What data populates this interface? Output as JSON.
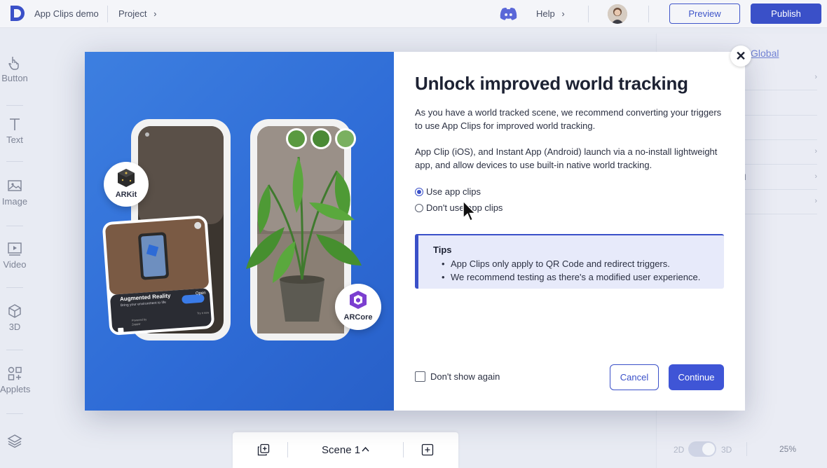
{
  "topbar": {
    "app_name": "App Clips demo",
    "project_label": "Project",
    "project_chevron": "›",
    "help_label": "Help",
    "help_chevron": "›",
    "preview_label": "Preview",
    "publish_label": "Publish"
  },
  "sidebar": {
    "items": [
      {
        "label": "Button",
        "icon": "hand-pointer-icon"
      },
      {
        "label": "Text",
        "icon": "text-icon"
      },
      {
        "label": "Image",
        "icon": "image-icon"
      },
      {
        "label": "Video",
        "icon": "video-icon"
      },
      {
        "label": "3D",
        "icon": "cube-icon"
      },
      {
        "label": "Applets",
        "icon": "applets-icon"
      },
      {
        "label": "",
        "icon": "layers-icon"
      }
    ]
  },
  "right_panel": {
    "tab_global": "Global",
    "row_partial": "d",
    "zoom": "25%",
    "toggle_2d": "2D",
    "toggle_3d": "3D"
  },
  "scenebar": {
    "scene_label": "Scene 1",
    "chevron": "^"
  },
  "modal": {
    "title": "Unlock improved world tracking",
    "para1": "As you have a world tracked scene, we recommend converting your triggers to use App Clips for improved world tracking.",
    "para2": "App Clip (iOS), and Instant App (Android) launch via a no-install lightweight app, and allow devices to use built-in native world tracking.",
    "radio_use": "Use app clips",
    "radio_dont": "Don't use app clips",
    "radio_selected": "use",
    "tips_title": "Tips",
    "tips": [
      "App Clips only apply to QR Code and redirect triggers.",
      "We recommend testing as there's a modified user experience."
    ],
    "dont_show": "Don't show again",
    "cancel_label": "Cancel",
    "continue_label": "Continue",
    "close_glyph": "✕",
    "art": {
      "arkit_label": "ARKit",
      "arcore_label": "ARCore",
      "ar_card_title": "Augmented Reality",
      "ar_card_sub": "Bring your environment to life",
      "ar_card_button": "Open",
      "ar_card_brand": "Zappar",
      "ar_card_brand_by": "Powered by",
      "ar_card_more": "Try it now"
    }
  },
  "colors": {
    "accent": "#3a50c8",
    "art_blue": "#2e6bd6",
    "tips_bg": "#e7eafa"
  }
}
